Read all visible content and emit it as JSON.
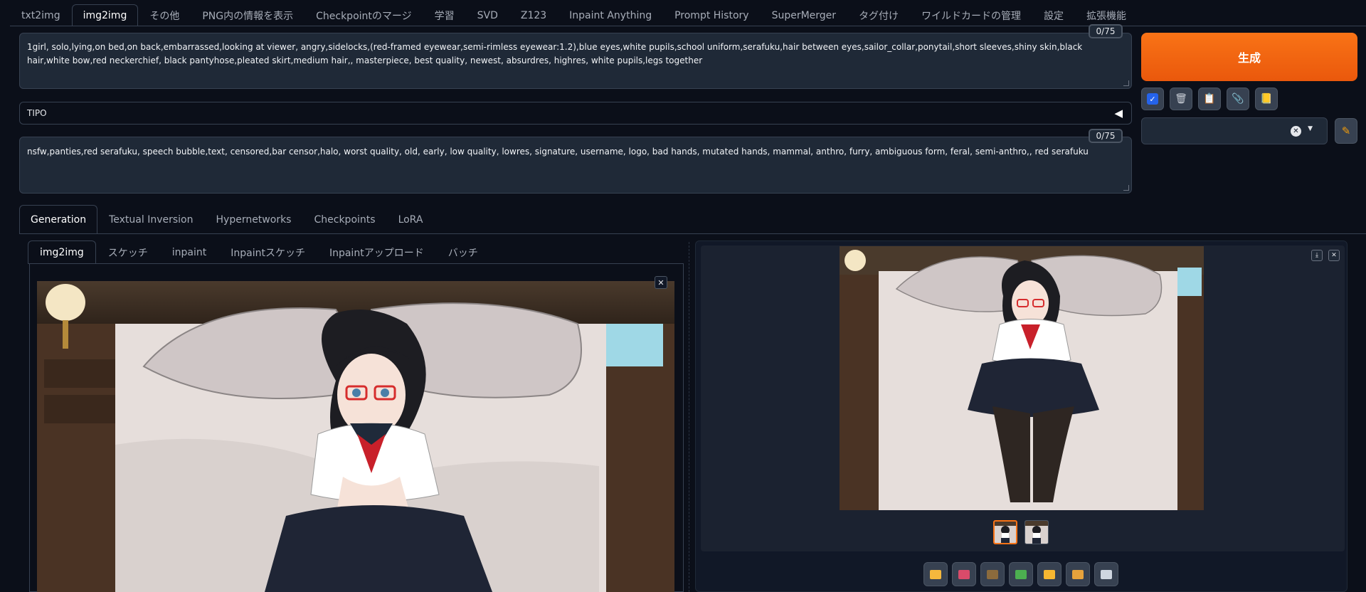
{
  "top_tabs": [
    {
      "label": "txt2img",
      "active": false
    },
    {
      "label": "img2img",
      "active": true
    },
    {
      "label": "その他",
      "active": false
    },
    {
      "label": "PNG内の情報を表示",
      "active": false
    },
    {
      "label": "Checkpointのマージ",
      "active": false
    },
    {
      "label": "学習",
      "active": false
    },
    {
      "label": "SVD",
      "active": false
    },
    {
      "label": "Z123",
      "active": false
    },
    {
      "label": "Inpaint Anything",
      "active": false
    },
    {
      "label": "Prompt History",
      "active": false
    },
    {
      "label": "SuperMerger",
      "active": false
    },
    {
      "label": "タグ付け",
      "active": false
    },
    {
      "label": "ワイルドカードの管理",
      "active": false
    },
    {
      "label": "設定",
      "active": false
    },
    {
      "label": "拡張機能",
      "active": false
    }
  ],
  "prompt": {
    "text": "1girl, solo,lying,on bed,on back,embarrassed,looking at viewer, angry,sidelocks,(red-framed eyewear,semi-rimless eyewear:1.2),blue eyes,white pupils,school uniform,serafuku,hair between eyes,sailor_collar,ponytail,short sleeves,shiny skin,black hair,white bow,red neckerchief, black pantyhose,pleated skirt,medium hair,, masterpiece, best quality, newest, absurdres, highres, white pupils,legs together",
    "counter": "0/75"
  },
  "tipo": {
    "label": "TIPO",
    "arrow": "◀"
  },
  "negative_prompt": {
    "text": "nsfw,panties,red serafuku, speech bubble,text, censored,bar censor,halo, worst quality, old, early, low quality, lowres, signature, username, logo, bad hands, mutated hands, mammal, anthro, furry, ambiguous form, feral, semi-anthro,, red serafuku",
    "counter": "0/75"
  },
  "generate_button": {
    "label": "生成"
  },
  "tool_buttons": [
    {
      "name": "checkbox-icon",
      "glyph": "✓"
    },
    {
      "name": "trash-icon",
      "glyph": "🗑"
    },
    {
      "name": "clipboard-icon",
      "glyph": "📋"
    },
    {
      "name": "paperclip-icon",
      "glyph": "📎"
    },
    {
      "name": "note-icon",
      "glyph": "📒"
    }
  ],
  "styles_dropdown": {
    "clear": "✕",
    "caret": "▼"
  },
  "edit_style_icon": "✎",
  "generation_tabs": [
    {
      "label": "Generation",
      "active": true
    },
    {
      "label": "Textual Inversion",
      "active": false
    },
    {
      "label": "Hypernetworks",
      "active": false
    },
    {
      "label": "Checkpoints",
      "active": false
    },
    {
      "label": "LoRA",
      "active": false
    }
  ],
  "img2img_tabs": [
    {
      "label": "img2img",
      "active": true
    },
    {
      "label": "スケッチ",
      "active": false
    },
    {
      "label": "inpaint",
      "active": false
    },
    {
      "label": "Inpaintスケッチ",
      "active": false
    },
    {
      "label": "Inpaintアップロード",
      "active": false
    },
    {
      "label": "バッチ",
      "active": false
    }
  ],
  "close_glyph": "✕",
  "download_glyph": "⤓",
  "action_buttons": [
    {
      "name": "open-folder-icon",
      "color": "#f5b83d"
    },
    {
      "name": "save-icon",
      "color": "#d94b6a"
    },
    {
      "name": "zip-icon",
      "color": "#8b6b3d"
    },
    {
      "name": "send-to-img2img-icon",
      "color": "#4caf50"
    },
    {
      "name": "send-to-inpaint-icon",
      "color": "#f7b731"
    },
    {
      "name": "send-to-extras-icon",
      "color": "#e6a23c"
    },
    {
      "name": "clapper-icon",
      "color": "#cfd6e0"
    }
  ],
  "colors": {
    "accent": "#f97316",
    "background": "#0b0f19",
    "panel": "#1f2937"
  }
}
